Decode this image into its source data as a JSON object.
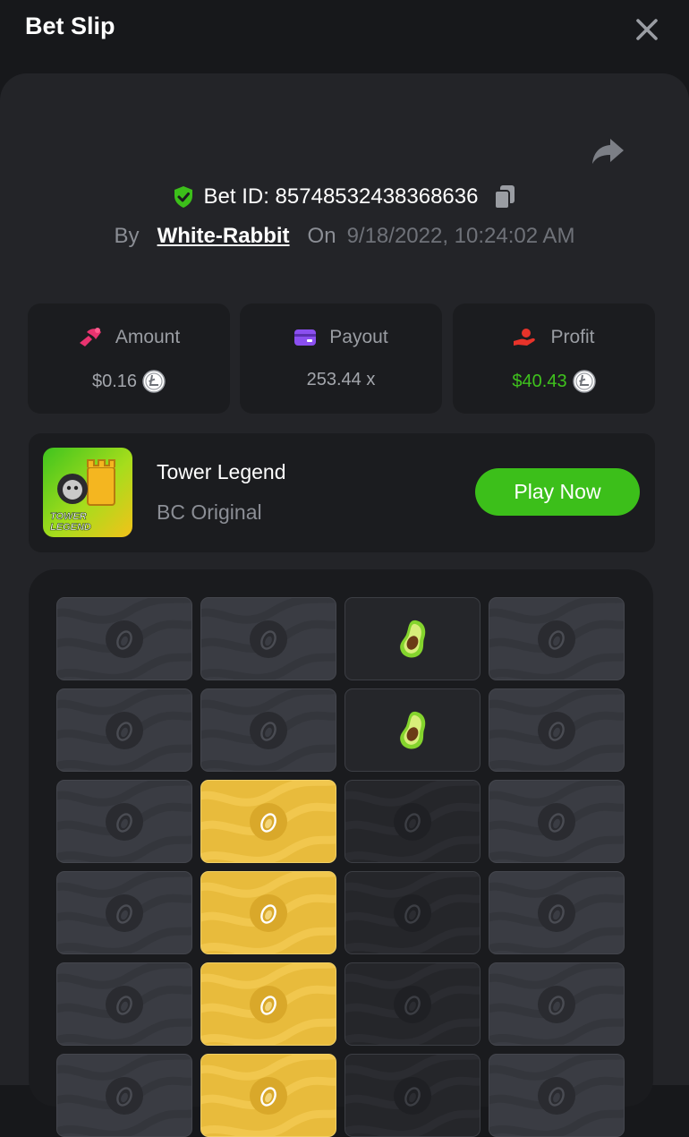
{
  "header": {
    "title": "Bet Slip"
  },
  "bet": {
    "id_label": "Bet ID: 857485324383686​36",
    "by_label": "By",
    "user": "White-Rabbit",
    "on_label": "On",
    "date": "9/18/2022, 10:24:02 AM"
  },
  "stats": {
    "amount": {
      "label": "Amount",
      "value": "$0.16"
    },
    "payout": {
      "label": "Payout",
      "value": "253.44 x"
    },
    "profit": {
      "label": "Profit",
      "value": "$40.43"
    }
  },
  "game": {
    "name": "Tower Legend",
    "type": "BC Original",
    "play_label": "Play Now",
    "thumb_text_1": "TOWER",
    "thumb_text_2": "LEGEND"
  },
  "board": {
    "rows": [
      [
        "gray",
        "gray",
        "dark-avocado",
        "gray"
      ],
      [
        "gray",
        "gray",
        "dark-avocado",
        "gray"
      ],
      [
        "gray",
        "gold",
        "dark",
        "gray"
      ],
      [
        "gray",
        "gold",
        "dark",
        "gray"
      ],
      [
        "gray",
        "gold",
        "dark",
        "gray"
      ],
      [
        "gray",
        "gold",
        "dark",
        "gray"
      ]
    ]
  },
  "colors": {
    "accent_green": "#3cbf1a",
    "profit_green": "#3fc21d",
    "gold_tile": "#e8bb3c",
    "amount_pink": "#e8336f",
    "payout_purple": "#8b4ff0",
    "profit_red": "#e8332a"
  },
  "icons": {
    "close": "close-icon",
    "share": "share-icon",
    "shield": "shield-check-icon",
    "copy": "copy-icon",
    "coin": "litecoin-icon",
    "tile": "avocado-seed-icon",
    "avocado": "avocado-icon"
  }
}
